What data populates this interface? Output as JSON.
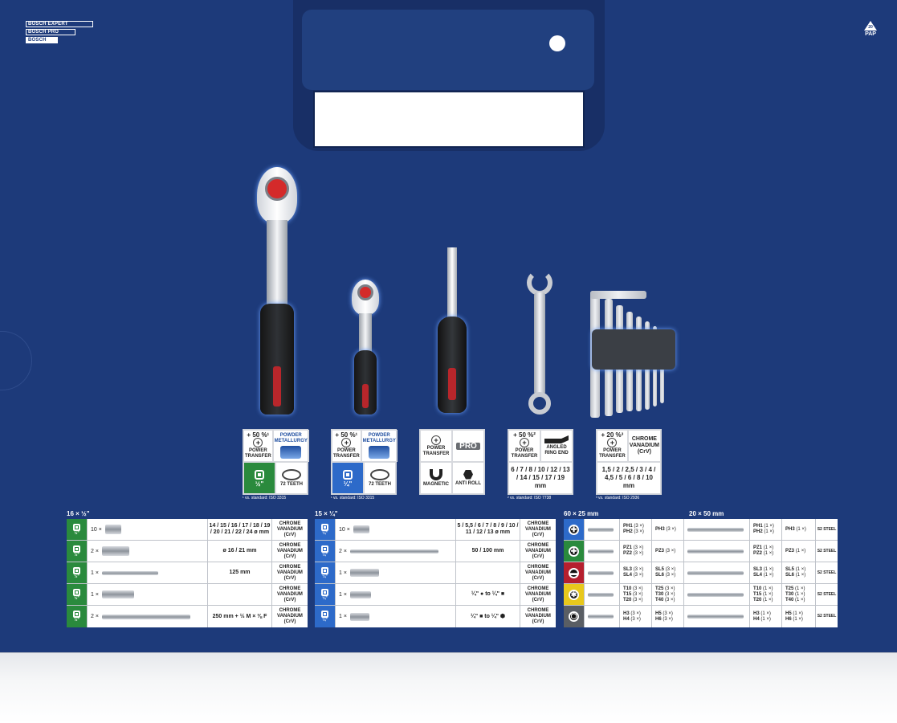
{
  "brand": {
    "tags": [
      "BOSCH EXPERT",
      "BOSCH PRO",
      "BOSCH"
    ],
    "pap_code": "20",
    "pap_label": "PAP"
  },
  "cards": [
    {
      "id": "ratchet-half",
      "top_left_pct": "+ 50 %¹",
      "top_left_label": "POWER TRANSFER",
      "top_right_label": "POWDER METALLURGY",
      "bottom_left_label": "½\"",
      "bottom_right_label": "72 TEETH",
      "footnote": "¹ vs. standard: ISO 3315"
    },
    {
      "id": "ratchet-quarter",
      "top_left_pct": "+ 50 %¹",
      "top_left_label": "POWER TRANSFER",
      "top_right_label": "POWDER METALLURGY",
      "bottom_left_label": "¼\"",
      "bottom_right_label": "72 TEETH",
      "footnote": "¹ vs. standard: ISO 3315"
    },
    {
      "id": "screwdriver",
      "top_left_label": "POWER TRANSFER",
      "top_right_label": "PRO",
      "bottom_left_label": "MAGNETIC",
      "bottom_right_label": "ANTI ROLL"
    },
    {
      "id": "wrench",
      "top_left_pct": "+ 50 %²",
      "top_left_label": "POWER TRANSFER",
      "top_right_label": "ANGLED RING END",
      "sizes": "6 / 7 / 8 / 10 / 12 / 13 / 14 / 15 / 17 / 19 mm",
      "footnote": "² vs. standard: ISO 7738"
    },
    {
      "id": "hexkeys",
      "top_left_pct": "+ 20 %³",
      "top_left_label": "POWER TRANSFER",
      "top_right_label": "CHROME VANADIUM (CrV)",
      "sizes": "1,5 / 2 / 2,5 / 3 / 4 / 4,5 / 5 / 6 / 8 / 10 mm",
      "footnote": "³ vs. standard: ISO 2936"
    }
  ],
  "half_inch": {
    "title": "16 × ½\"",
    "drive": "½\"",
    "rows": [
      {
        "qty": "10 ×",
        "dims": "14 / 15 / 16 / 17 / 18 / 19 / 20 / 21 / 22 / 24 ø mm",
        "material": "CHROME VANADIUM (CrV)"
      },
      {
        "qty": "2 ×",
        "dims": "ø 16 / 21 mm",
        "material": "CHROME VANADIUM (CrV)"
      },
      {
        "qty": "1 ×",
        "dims": "125 mm",
        "material": "CHROME VANADIUM (CrV)"
      },
      {
        "qty": "1 ×",
        "dims": "",
        "material": "CHROME VANADIUM (CrV)"
      },
      {
        "qty": "2 ×",
        "dims": "250 mm + ½ M × ⅜ F",
        "material": "CHROME VANADIUM (CrV)"
      }
    ]
  },
  "quarter_inch": {
    "title": "15 × ¼\"",
    "drive": "¼\"",
    "rows": [
      {
        "qty": "10 ×",
        "dims": "5 / 5,5 / 6 / 7 / 8 / 9 / 10 / 11 / 12 / 13 ø mm",
        "material": "CHROME VANADIUM (CrV)"
      },
      {
        "qty": "2 ×",
        "dims": "50 / 100 mm",
        "material": "CHROME VANADIUM (CrV)"
      },
      {
        "qty": "1 ×",
        "dims": "",
        "material": "CHROME VANADIUM (CrV)"
      },
      {
        "qty": "1 ×",
        "dims": "¼\" ● to ¼\" ■",
        "material": "CHROME VANADIUM (CrV)"
      },
      {
        "qty": "1 ×",
        "dims": "¼\" ■ to ¼\" ⬢",
        "material": "CHROME VANADIUM (CrV)"
      }
    ]
  },
  "bits_25": {
    "title": "60 × 25 mm",
    "rows": [
      {
        "color": "#2d6ac9",
        "symbol": "✚",
        "a1": "PH1",
        "a1n": "(3 ×)",
        "a2": "PH2",
        "a2n": "(3 ×)",
        "b1": "PH3",
        "b1n": "(3 ×)",
        "b2": "",
        "b2n": "",
        "b3": "",
        "b3n": ""
      },
      {
        "color": "#2a8a3d",
        "symbol": "✚",
        "a1": "PZ1",
        "a1n": "(3 ×)",
        "a2": "PZ2",
        "a2n": "(3 ×)",
        "b1": "PZ3",
        "b1n": "(3 ×)",
        "b2": "",
        "b2n": "",
        "b3": "",
        "b3n": ""
      },
      {
        "color": "#b51f2e",
        "symbol": "▬",
        "a1": "SL3",
        "a1n": "(3 ×)",
        "a2": "SL4",
        "a2n": "(3 ×)",
        "b1": "SL5",
        "b1n": "(3 ×)",
        "b2": "SL6",
        "b2n": "(3 ×)",
        "b3": "",
        "b3n": ""
      },
      {
        "color": "#e8c81c",
        "symbol": "✱",
        "a1": "T10",
        "a1n": "(3 ×)",
        "a2": "T15",
        "a2n": "(3 ×)",
        "a3": "T20",
        "a3n": "(3 ×)",
        "b1": "T25",
        "b1n": "(3 ×)",
        "b2": "T30",
        "b2n": "(3 ×)",
        "b3": "T40",
        "b3n": "(3 ×)"
      },
      {
        "color": "#5a5e64",
        "symbol": "⬡",
        "a1": "H3",
        "a1n": "(3 ×)",
        "a2": "H4",
        "a2n": "(3 ×)",
        "b1": "H5",
        "b1n": "(3 ×)",
        "b2": "H6",
        "b2n": "(3 ×)",
        "b3": "",
        "b3n": ""
      }
    ]
  },
  "bits_50": {
    "title": "20 × 50 mm",
    "material": "S2 STEEL",
    "rows": [
      {
        "a1": "PH1",
        "a1n": "(1 ×)",
        "a2": "PH2",
        "a2n": "(1 ×)",
        "b1": "PH3",
        "b1n": "(1 ×)",
        "b2": "",
        "b2n": "",
        "b3": "",
        "b3n": ""
      },
      {
        "a1": "PZ1",
        "a1n": "(1 ×)",
        "a2": "PZ2",
        "a2n": "(1 ×)",
        "b1": "PZ3",
        "b1n": "(1 ×)",
        "b2": "",
        "b2n": "",
        "b3": "",
        "b3n": ""
      },
      {
        "a1": "SL3",
        "a1n": "(1 ×)",
        "a2": "SL4",
        "a2n": "(1 ×)",
        "b1": "SL5",
        "b1n": "(1 ×)",
        "b2": "SL6",
        "b2n": "(1 ×)",
        "b3": "",
        "b3n": ""
      },
      {
        "a1": "T10",
        "a1n": "(1 ×)",
        "a2": "T15",
        "a2n": "(1 ×)",
        "a3": "T20",
        "a3n": "(1 ×)",
        "b1": "T25",
        "b1n": "(1 ×)",
        "b2": "T30",
        "b2n": "(1 ×)",
        "b3": "T40",
        "b3n": "(1 ×)"
      },
      {
        "a1": "H3",
        "a1n": "(1 ×)",
        "a2": "H4",
        "a2n": "(1 ×)",
        "b1": "H5",
        "b1n": "(1 ×)",
        "b2": "H6",
        "b2n": "(1 ×)",
        "b3": "",
        "b3n": ""
      }
    ]
  },
  "colors": {
    "board": "#1d3a7a",
    "half_inch": "#2a8a3d",
    "quarter_inch": "#2d6ac9"
  }
}
